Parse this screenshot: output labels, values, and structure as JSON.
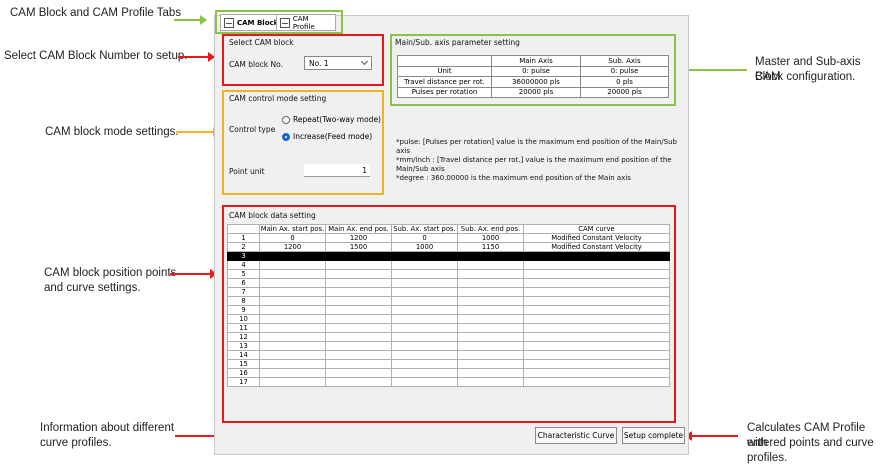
{
  "annotations": {
    "tabs": "CAM Block and CAM Profile Tabs",
    "block_no": "Select CAM Block Number to setup.",
    "mode": "CAM block mode settings.",
    "points_l1": "CAM block position points",
    "points_l2": "and curve settings.",
    "info_l1": "Information about different",
    "info_l2": "curve profiles.",
    "axis_l1": "Master and Sub-axis CAM",
    "axis_l2": "Block configuration.",
    "calc_l1": "Calculates CAM Profile with",
    "calc_l2": "entered points and curve",
    "calc_l3": "profiles."
  },
  "tabs": {
    "block": "CAM Block",
    "profile": "CAM Profile"
  },
  "select_block": {
    "title": "Select CAM block",
    "label": "CAM block No.",
    "value": "No. 1"
  },
  "param": {
    "title": "Main/Sub. axis parameter setting",
    "headers": [
      "",
      "Main Axis",
      "Sub. Axis"
    ],
    "rows": [
      [
        "Unit",
        "0: pulse",
        "0: pulse"
      ],
      [
        "Travel distance per rot.",
        "36000000 pls",
        "0 pls"
      ],
      [
        "Pulses per rotation",
        "20000 pls",
        "20000 pls"
      ]
    ]
  },
  "mode": {
    "title": "CAM control mode setting",
    "control_type_label": "Control type",
    "opt_repeat": "Repeat(Two-way mode)",
    "opt_increase": "Increase(Feed mode)",
    "selected": "increase",
    "point_unit_label": "Point unit",
    "point_unit_value": "1"
  },
  "notes": {
    "n1a": "*pulse: [Pulses per rotation] value is the maximum end position of the Main/Sub",
    "n1b": "axis",
    "n2a": "*mm/inch : [Travel distance per rot.] value is the maximum end position of the",
    "n2b": "Main/Sub axis",
    "n3": "*degree : 360.00000 is the maximum end position of the Main axis"
  },
  "data": {
    "title": "CAM block data setting",
    "headers": [
      "",
      "Main Ax. start pos.",
      "Main Ax. end pos.",
      "Sub. Ax. start pos.",
      "Sub. Ax. end pos.",
      "CAM curve"
    ],
    "rows": [
      [
        "1",
        "0",
        "1200",
        "0",
        "1000",
        "Modified Constant Velocity"
      ],
      [
        "2",
        "1200",
        "1500",
        "1000",
        "1150",
        "Modified Constant Velocity"
      ],
      [
        "3",
        "",
        "",
        "",
        "",
        ""
      ],
      [
        "4",
        "",
        "",
        "",
        "",
        ""
      ],
      [
        "5",
        "",
        "",
        "",
        "",
        ""
      ],
      [
        "6",
        "",
        "",
        "",
        "",
        ""
      ],
      [
        "7",
        "",
        "",
        "",
        "",
        ""
      ],
      [
        "8",
        "",
        "",
        "",
        "",
        ""
      ],
      [
        "9",
        "",
        "",
        "",
        "",
        ""
      ],
      [
        "10",
        "",
        "",
        "",
        "",
        ""
      ],
      [
        "11",
        "",
        "",
        "",
        "",
        ""
      ],
      [
        "12",
        "",
        "",
        "",
        "",
        ""
      ],
      [
        "13",
        "",
        "",
        "",
        "",
        ""
      ],
      [
        "14",
        "",
        "",
        "",
        "",
        ""
      ],
      [
        "15",
        "",
        "",
        "",
        "",
        ""
      ],
      [
        "16",
        "",
        "",
        "",
        "",
        ""
      ],
      [
        "17",
        "",
        "",
        "",
        "",
        ""
      ]
    ],
    "selected_row": 3
  },
  "buttons": {
    "characteristic": "Characteristic Curve",
    "setup": "Setup complete"
  },
  "colors": {
    "red": "#e8181c",
    "yellow": "#f0b323",
    "green": "#8bc34a",
    "radio_on": "#1a66c9"
  }
}
